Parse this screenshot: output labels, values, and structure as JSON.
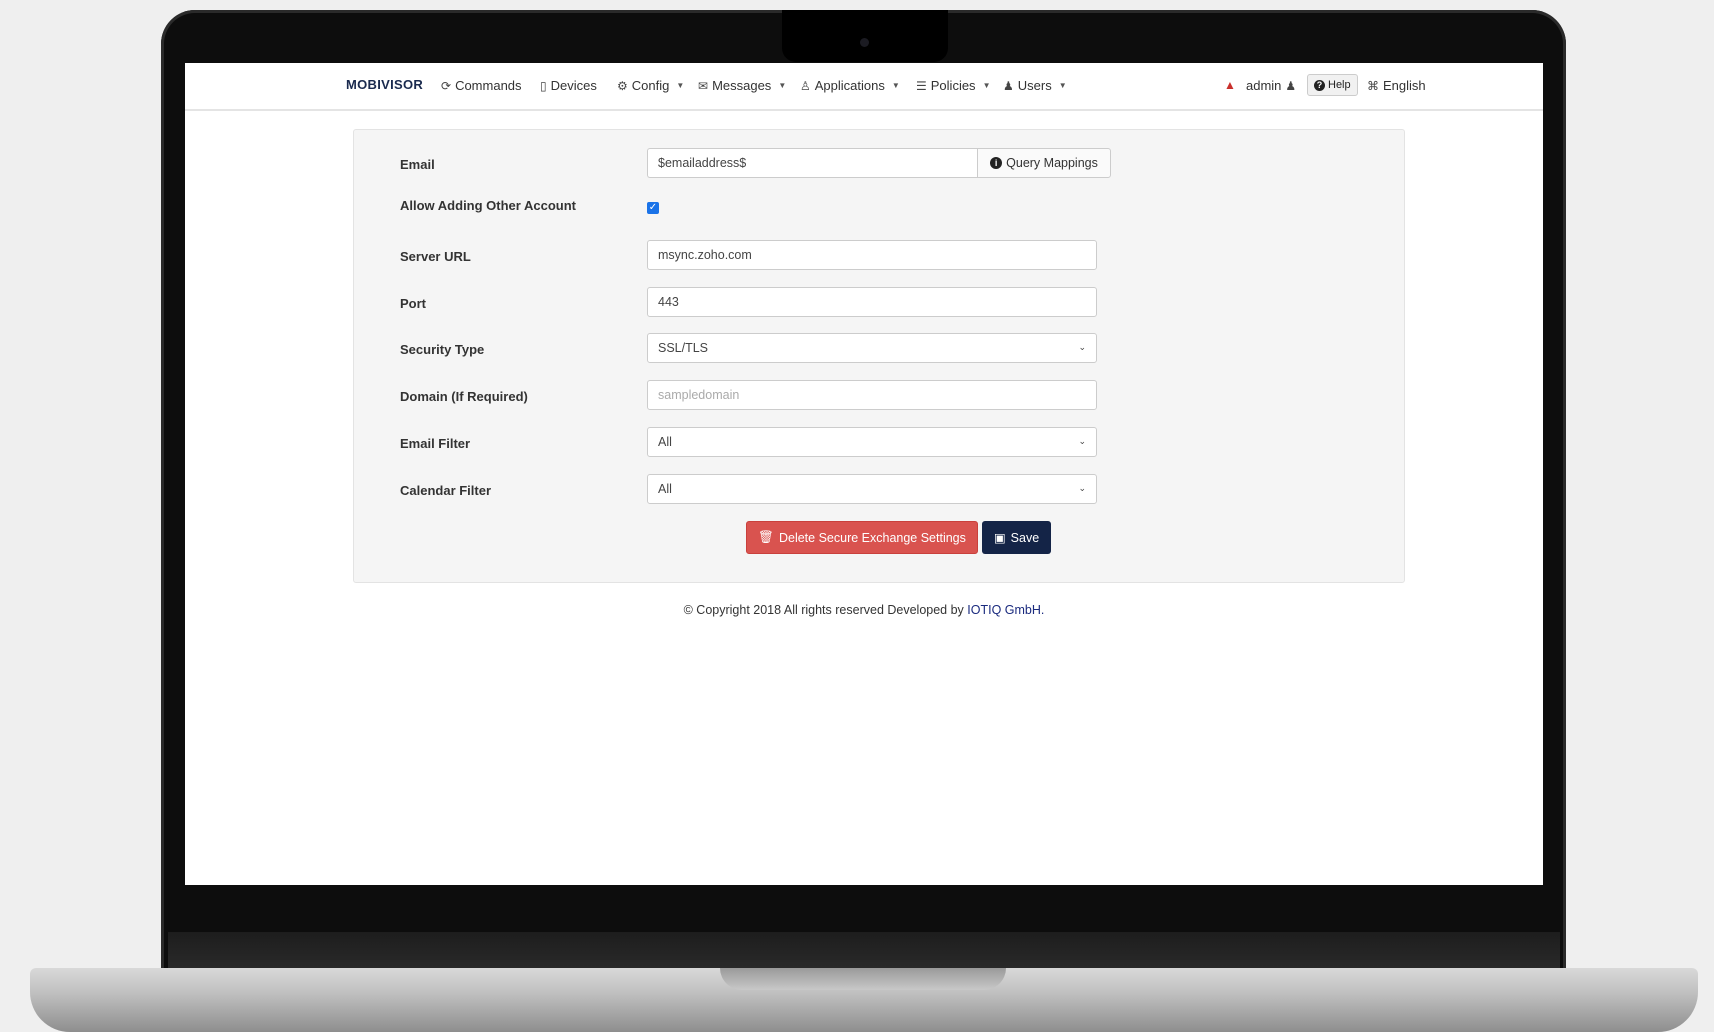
{
  "navbar": {
    "brand": "MOBIVISOR",
    "items": [
      {
        "label": "Commands",
        "icon": "refresh-icon"
      },
      {
        "label": "Devices",
        "icon": "mobile-icon"
      },
      {
        "label": "Config",
        "icon": "gear-icon"
      },
      {
        "label": "Messages",
        "icon": "envelope-icon"
      },
      {
        "label": "Applications",
        "icon": "user-app-icon"
      },
      {
        "label": "Policies",
        "icon": "list-icon"
      },
      {
        "label": "Users",
        "icon": "user-icon"
      }
    ],
    "user": "admin",
    "help": "Help",
    "language": "English"
  },
  "form": {
    "email": {
      "label": "Email",
      "value": "$emailaddress$",
      "addon": "Query Mappings"
    },
    "allow_other": {
      "label": "Allow Adding Other Account",
      "checked": true
    },
    "server_url": {
      "label": "Server URL",
      "value": "msync.zoho.com"
    },
    "port": {
      "label": "Port",
      "value": "443"
    },
    "security_type": {
      "label": "Security Type",
      "value": "SSL/TLS"
    },
    "domain": {
      "label": "Domain (If Required)",
      "placeholder": "sampledomain"
    },
    "email_filter": {
      "label": "Email Filter",
      "value": "All"
    },
    "calendar_filter": {
      "label": "Calendar Filter",
      "value": "All"
    }
  },
  "buttons": {
    "delete": "Delete Secure Exchange Settings",
    "save": "Save"
  },
  "footer": {
    "text": "© Copyright 2018 All rights reserved Developed by ",
    "link": "IOTIQ GmbH."
  },
  "colors": {
    "danger": "#d9534f",
    "primary_dark": "#142447",
    "checkbox": "#1a73e8"
  }
}
